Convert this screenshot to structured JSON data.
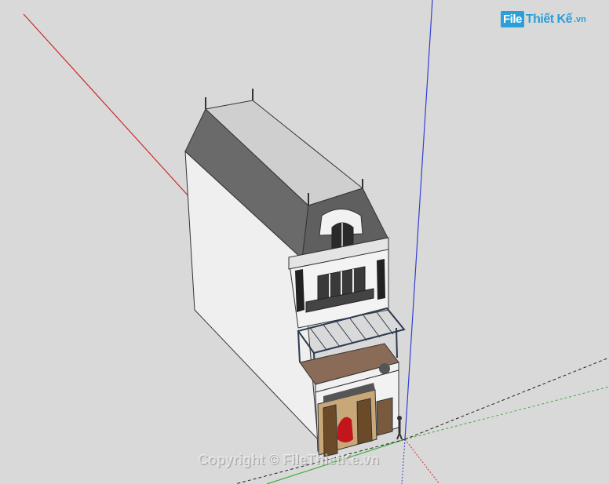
{
  "logo": {
    "badge": "File",
    "name": "Thiết Kế",
    "ext": ".vn"
  },
  "watermark": "Copyright © FileThietKe.vn",
  "colors": {
    "background": "#d9d9d9",
    "axis_red": "#cc2b2b",
    "axis_green": "#3fae3f",
    "axis_blue": "#2f3fcf",
    "roof": "#6a6a6a",
    "wall": "#efefef",
    "floor": "#8a6b57",
    "logo": "#2a9fd8"
  }
}
